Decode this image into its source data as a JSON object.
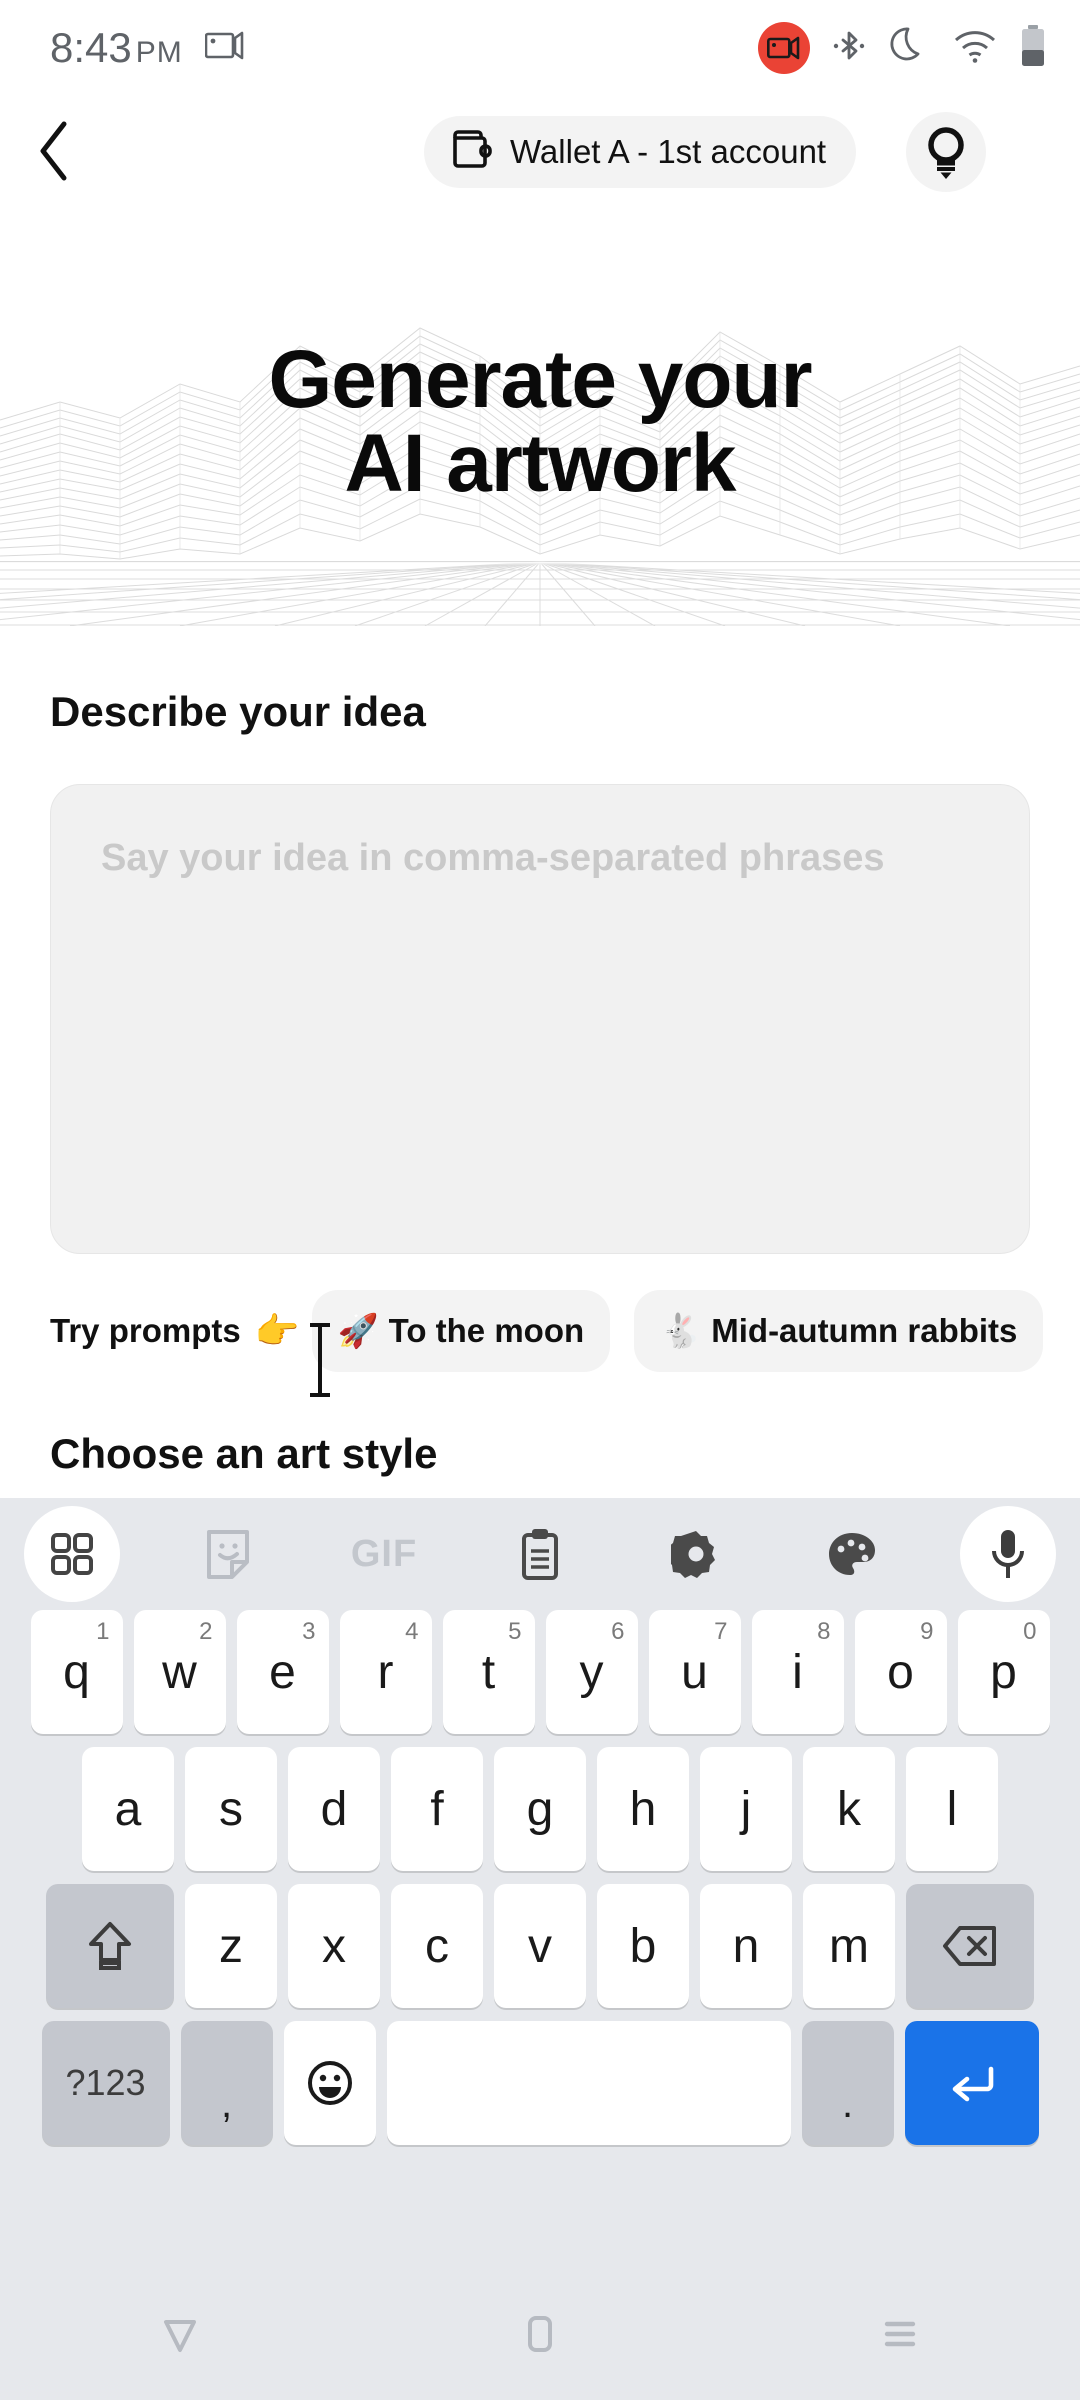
{
  "status_bar": {
    "time": "8:43",
    "ampm": "PM",
    "icons": [
      {
        "name": "screen-record-icon",
        "color": "#ea4335"
      },
      {
        "name": "bluetooth-icon"
      },
      {
        "name": "do-not-disturb-moon-icon"
      },
      {
        "name": "wifi-icon"
      },
      {
        "name": "battery-icon"
      }
    ],
    "cast_icon": "screen-cast-icon"
  },
  "app_bar": {
    "back_icon": "back-chevron-icon",
    "wallet_icon": "wallet-icon",
    "wallet_label": "Wallet A - 1st account",
    "bulb_icon": "lightbulb-icon"
  },
  "hero": {
    "title_line1": "Generate your",
    "title_line2": "AI artwork",
    "background": "wireframe-terrain-grid"
  },
  "main": {
    "describe_heading": "Describe your idea",
    "idea_input": {
      "value": "",
      "placeholder": "Say your idea in comma-separated phrases"
    },
    "try_prompts_label": "Try prompts",
    "try_prompts_emoji": "👉",
    "prompt_chips": [
      {
        "emoji": "🚀",
        "label": "To the moon"
      },
      {
        "emoji": "🐇",
        "label": "Mid-autumn rabbits"
      }
    ],
    "art_style_heading": "Choose an art style"
  },
  "keyboard": {
    "toolbar": [
      {
        "name": "apps-grid-icon",
        "filled": true
      },
      {
        "name": "sticker-icon",
        "filled": false
      },
      {
        "name": "gif-icon",
        "filled": false,
        "label": "GIF"
      },
      {
        "name": "clipboard-icon",
        "filled": false
      },
      {
        "name": "settings-gear-icon",
        "filled": false
      },
      {
        "name": "palette-theme-icon",
        "filled": false
      },
      {
        "name": "microphone-icon",
        "filled": true
      }
    ],
    "row1": [
      {
        "key": "q",
        "sup": "1"
      },
      {
        "key": "w",
        "sup": "2"
      },
      {
        "key": "e",
        "sup": "3"
      },
      {
        "key": "r",
        "sup": "4"
      },
      {
        "key": "t",
        "sup": "5"
      },
      {
        "key": "y",
        "sup": "6"
      },
      {
        "key": "u",
        "sup": "7"
      },
      {
        "key": "i",
        "sup": "8"
      },
      {
        "key": "o",
        "sup": "9"
      },
      {
        "key": "p",
        "sup": "0"
      }
    ],
    "row2": [
      "a",
      "s",
      "d",
      "f",
      "g",
      "h",
      "j",
      "k",
      "l"
    ],
    "row3": [
      "z",
      "x",
      "c",
      "v",
      "b",
      "n",
      "m"
    ],
    "shift_icon": "shift-arrow-icon",
    "backspace_icon": "backspace-icon",
    "symbols_label": "?123",
    "comma_label": ",",
    "emoji_icon": "emoji-smiley-icon",
    "space_label": "",
    "period_label": ".",
    "enter_icon": "enter-return-icon",
    "enter_color": "#1a73e8"
  },
  "nav_bar": {
    "back_icon": "nav-back-triangle-icon",
    "home_icon": "nav-home-square-icon",
    "recents_icon": "nav-recents-lines-icon"
  }
}
